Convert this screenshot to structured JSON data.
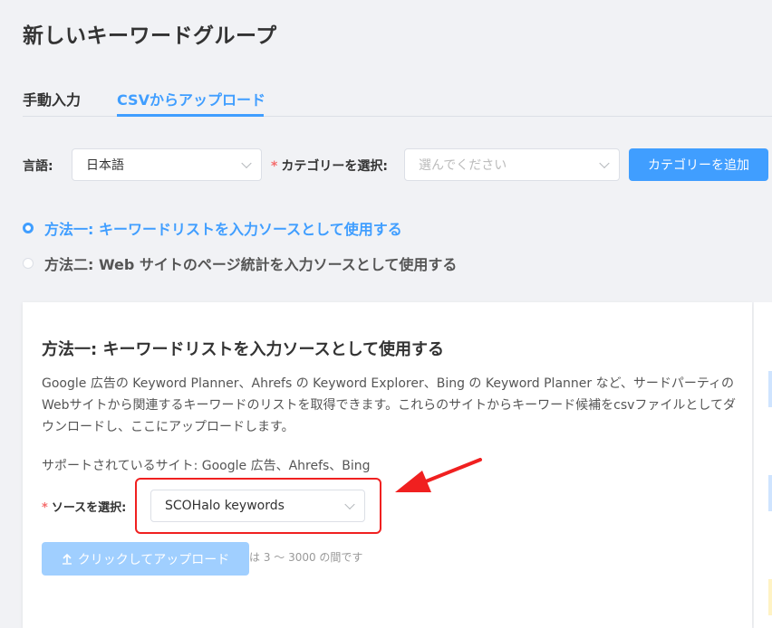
{
  "page": {
    "title": "新しいキーワードグループ"
  },
  "tabs": [
    {
      "label": "手動入力",
      "active": false
    },
    {
      "label": "CSVからアップロード",
      "active": true
    }
  ],
  "filters": {
    "language_label": "言語:",
    "language_value": "日本語",
    "category_required": "*",
    "category_label": "カテゴリーを選択:",
    "category_placeholder": "選んでください",
    "add_category_button": "カテゴリーを追加"
  },
  "methods": [
    {
      "label": "方法一:  キーワードリストを入力ソースとして使用する",
      "selected": true
    },
    {
      "label": "方法二: Web サイトのページ統計を入力ソースとして使用する",
      "selected": false
    }
  ],
  "card": {
    "title": "方法一:  キーワードリストを入力ソースとして使用する",
    "description": "Google 広告の Keyword Planner、Ahrefs の Keyword Explorer、Bing の Keyword Planner など、サードパーティのWebサイトから関連するキーワードのリストを取得できます。これらのサイトからキーワード候補をcsvファイルとしてダウンロードし、ここにアップロードします。",
    "supported_sites": "サポートされているサイト: Google 広告、Ahrefs、Bing",
    "source_required": "*",
    "source_label": "ソースを選択:",
    "source_value": "SCOHalo keywords",
    "upload_button": "クリックしてアップロード",
    "upload_hint": "は 3 ～ 3000 の間です"
  },
  "colors": {
    "accent": "#409eff",
    "annotation": "#f02020",
    "disabled_button": "#a0cfff"
  },
  "icons": {
    "upload": "upload-arrow-icon",
    "dropdown": "chevron-down-icon",
    "annotation": "red-arrow"
  }
}
